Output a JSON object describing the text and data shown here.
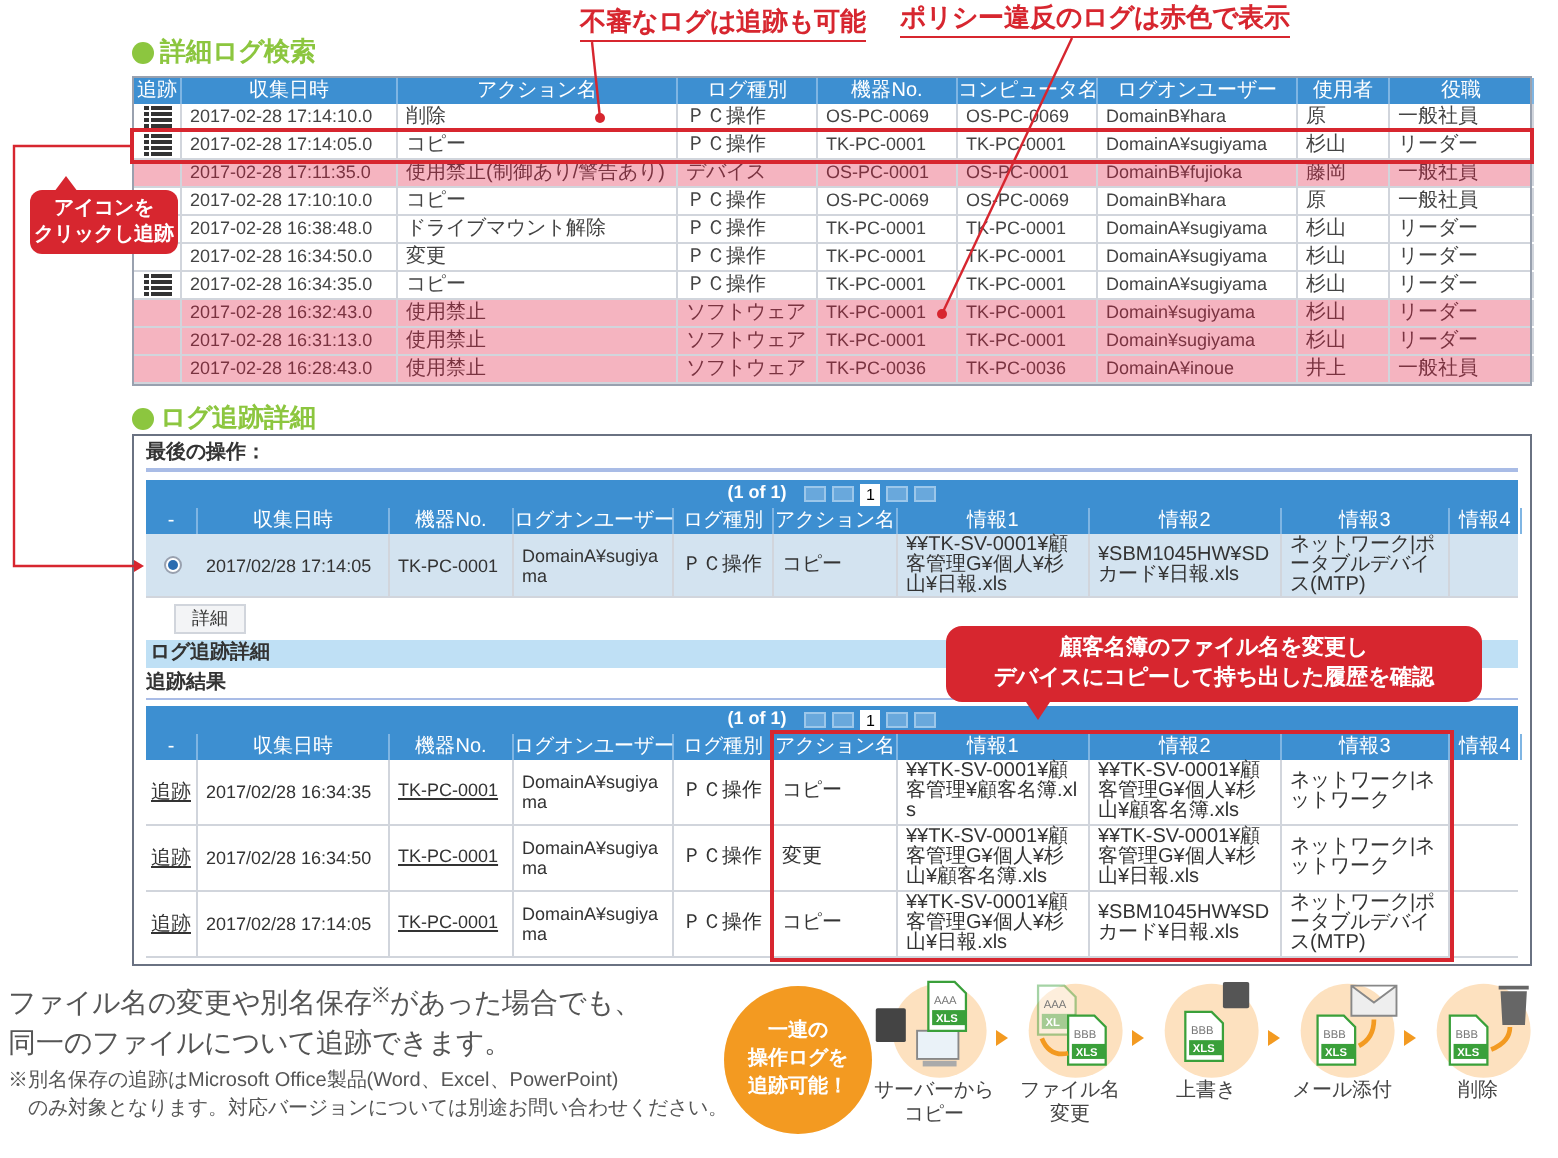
{
  "annotations": {
    "suspicious_note": "不審なログは追跡も可能",
    "policy_note": "ポリシー違反のログは赤色で表示",
    "icon_note": [
      "アイコンを",
      "クリックし追跡"
    ],
    "history_note": [
      "顧客名簿のファイル名を変更し",
      "デバイスにコピーして持ち出した履歴を確認"
    ]
  },
  "search": {
    "title": "詳細ログ検索",
    "track_header": "追跡",
    "columns": [
      "収集日時",
      "アクション名",
      "ログ種別",
      "機器No.",
      "コンピュータ名",
      "ログオンユーザー",
      "使用者",
      "役職"
    ],
    "rows": [
      {
        "trackable": true,
        "violation": false,
        "outlined": false,
        "cells": [
          "2017-02-28 17:14:10.0",
          "削除",
          "ＰＣ操作",
          "OS-PC-0069",
          "OS-PC-0069",
          "DomainB¥hara",
          "原",
          "一般社員"
        ]
      },
      {
        "trackable": true,
        "violation": false,
        "outlined": true,
        "cells": [
          "2017-02-28 17:14:05.0",
          "コピー",
          "ＰＣ操作",
          "TK-PC-0001",
          "TK-PC-0001",
          "DomainA¥sugiyama",
          "杉山",
          "リーダー"
        ]
      },
      {
        "trackable": false,
        "violation": true,
        "outlined": false,
        "cells": [
          "2017-02-28 17:11:35.0",
          "使用禁止(制御あり/警告あり)",
          "デバイス",
          "OS-PC-0001",
          "OS-PC-0001",
          "DomainB¥fujioka",
          "藤岡",
          "一般社員"
        ]
      },
      {
        "trackable": false,
        "violation": false,
        "outlined": false,
        "cells": [
          "2017-02-28 17:10:10.0",
          "コピー",
          "ＰＣ操作",
          "OS-PC-0069",
          "OS-PC-0069",
          "DomainB¥hara",
          "原",
          "一般社員"
        ]
      },
      {
        "trackable": false,
        "violation": false,
        "outlined": false,
        "cells": [
          "2017-02-28 16:38:48.0",
          "ドライブマウント解除",
          "ＰＣ操作",
          "TK-PC-0001",
          "TK-PC-0001",
          "DomainA¥sugiyama",
          "杉山",
          "リーダー"
        ]
      },
      {
        "trackable": false,
        "violation": false,
        "outlined": false,
        "cells": [
          "2017-02-28 16:34:50.0",
          "変更",
          "ＰＣ操作",
          "TK-PC-0001",
          "TK-PC-0001",
          "DomainA¥sugiyama",
          "杉山",
          "リーダー"
        ]
      },
      {
        "trackable": true,
        "violation": false,
        "outlined": false,
        "cells": [
          "2017-02-28 16:34:35.0",
          "コピー",
          "ＰＣ操作",
          "TK-PC-0001",
          "TK-PC-0001",
          "DomainA¥sugiyama",
          "杉山",
          "リーダー"
        ]
      },
      {
        "trackable": false,
        "violation": true,
        "outlined": false,
        "cells": [
          "2017-02-28 16:32:43.0",
          "使用禁止",
          "ソフトウェア",
          "TK-PC-0001",
          "TK-PC-0001",
          "Domain¥sugiyama",
          "杉山",
          "リーダー"
        ]
      },
      {
        "trackable": false,
        "violation": true,
        "outlined": false,
        "cells": [
          "2017-02-28 16:31:13.0",
          "使用禁止",
          "ソフトウェア",
          "TK-PC-0001",
          "TK-PC-0001",
          "Domain¥sugiyama",
          "杉山",
          "リーダー"
        ]
      },
      {
        "trackable": false,
        "violation": true,
        "outlined": false,
        "cells": [
          "2017-02-28 16:28:43.0",
          "使用禁止",
          "ソフトウェア",
          "TK-PC-0036",
          "TK-PC-0036",
          "DomainA¥inoue",
          "井上",
          "一般社員"
        ]
      }
    ]
  },
  "trace": {
    "title": "ログ追跡詳細",
    "last_op_label": "最後の操作：",
    "pager": {
      "summary": "(1 of 1)",
      "page": "1"
    },
    "select_header": "-",
    "columns": [
      "収集日時",
      "機器No.",
      "ログオンユーザー",
      "ログ種別",
      "アクション名",
      "情報1",
      "情報2",
      "情報3",
      "情報4"
    ],
    "rows": [
      {
        "selected": true,
        "cells": [
          "2017/02/28 17:14:05",
          "TK-PC-0001",
          "DomainA¥sugiyama",
          "ＰＣ操作",
          "コピー",
          "¥¥TK-SV-0001¥顧客管理G¥個人¥杉山¥日報.xls",
          "¥SBM1045HW¥SDカード¥日報.xls",
          "ネットワーク|ポータブルデバイス(MTP)"
        ]
      }
    ],
    "detail_button": "詳細",
    "section_bar": "ログ追跡詳細",
    "result_label": "追跡結果",
    "result_pager": {
      "summary": "(1 of 1)",
      "page": "1"
    },
    "result_select_header": "-",
    "result_columns": [
      "収集日時",
      "機器No.",
      "ログオンユーザー",
      "ログ種別",
      "アクション名",
      "情報1",
      "情報2",
      "情報3",
      "情報4"
    ],
    "result_rows": [
      {
        "link": "追跡",
        "cells": [
          "2017/02/28 16:34:35",
          "TK-PC-0001",
          "DomainA¥sugiyama",
          "ＰＣ操作",
          "コピー",
          "¥¥TK-SV-0001¥顧客管理¥顧客名簿.xls",
          "¥¥TK-SV-0001¥顧客管理G¥個人¥杉山¥顧客名簿.xls",
          "ネットワーク|ネットワーク"
        ]
      },
      {
        "link": "追跡",
        "cells": [
          "2017/02/28 16:34:50",
          "TK-PC-0001",
          "DomainA¥sugiyama",
          "ＰＣ操作",
          "変更",
          "¥¥TK-SV-0001¥顧客管理G¥個人¥杉山¥顧客名簿.xls",
          "¥¥TK-SV-0001¥顧客管理G¥個人¥杉山¥日報.xls",
          "ネットワーク|ネットワーク"
        ]
      },
      {
        "link": "追跡",
        "cells": [
          "2017/02/28 17:14:05",
          "TK-PC-0001",
          "DomainA¥sugiyama",
          "ＰＣ操作",
          "コピー",
          "¥¥TK-SV-0001¥顧客管理G¥個人¥杉山¥日報.xls",
          "¥SBM1045HW¥SDカード¥日報.xls",
          "ネットワーク|ポータブルデバイス(MTP)"
        ]
      }
    ]
  },
  "feature": {
    "lines": [
      "ファイル名の変更や別名保存$^{※}$があった場合でも、",
      "同一のファイルについて追跡できます。"
    ],
    "note_lines": [
      "※別名保存の追跡はMicrosoft Office製品(Word、Excel、PowerPoint)",
      "のみ対象となります。対応バージョンについては別途お問い合わせください。"
    ]
  },
  "flow": {
    "badge": [
      "一連の",
      "操作ログを",
      "追跡可能！"
    ],
    "steps": [
      {
        "kind": "server_copy",
        "label": [
          "サーバーから",
          "コピー"
        ],
        "files": [
          {
            "name": "AAA",
            "type": "XLS"
          }
        ]
      },
      {
        "kind": "rename",
        "label": [
          "ファイル名",
          "変更"
        ],
        "files": [
          {
            "name": "AAA",
            "type": "XL"
          },
          {
            "name": "BBB",
            "type": "XLS"
          }
        ]
      },
      {
        "kind": "overwrite",
        "label": [
          "上書き"
        ],
        "files": [
          {
            "name": "BBB",
            "type": "XLS"
          }
        ]
      },
      {
        "kind": "mail",
        "label": [
          "メール添付"
        ],
        "files": [
          {
            "name": "BBB",
            "type": "XLS"
          }
        ]
      },
      {
        "kind": "delete",
        "label": [
          "削除"
        ],
        "files": [
          {
            "name": "BBB",
            "type": "XLS"
          }
        ]
      }
    ]
  }
}
